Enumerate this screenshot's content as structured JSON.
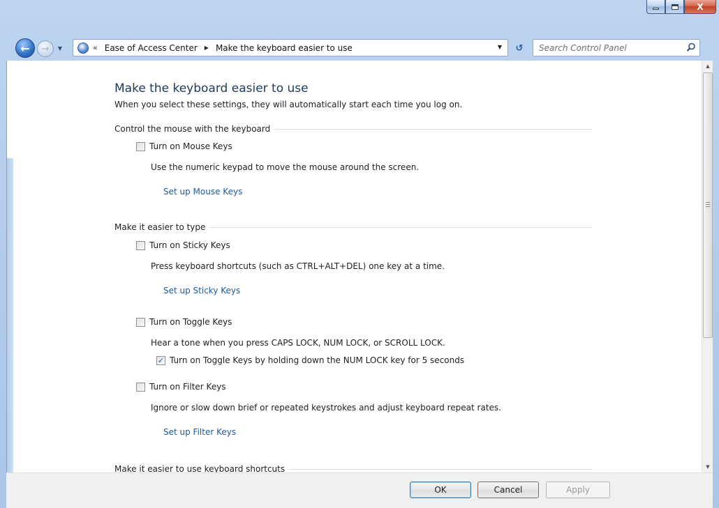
{
  "window": {
    "close_glyph": "X",
    "accent_color": "#1c5a9b",
    "frame_color": "#a9c6e8"
  },
  "navigation": {
    "breadcrumb_chevrons": "«",
    "breadcrumb": [
      "Ease of Access Center",
      "Make the keyboard easier to use"
    ],
    "search_placeholder": "Search Control Panel"
  },
  "page": {
    "title": "Make the keyboard easier to use",
    "description": "When you select these settings, they will automatically start each time you log on."
  },
  "sections": [
    {
      "label": "Control the mouse with the keyboard",
      "items": [
        {
          "checkbox_label": "Turn on Mouse Keys",
          "checked": false,
          "description": "Use the numeric keypad to move the mouse around the screen.",
          "link": "Set up Mouse Keys"
        }
      ]
    },
    {
      "label": "Make it easier to type",
      "items": [
        {
          "checkbox_label": "Turn on Sticky Keys",
          "checked": false,
          "description": "Press keyboard shortcuts (such as CTRL+ALT+DEL) one key at a time.",
          "link": "Set up Sticky Keys"
        },
        {
          "checkbox_label": "Turn on Toggle Keys",
          "checked": false,
          "description": "Hear a tone when you press CAPS LOCK, NUM LOCK, or SCROLL LOCK.",
          "sub_checkbox_label": "Turn on Toggle Keys by holding down the NUM LOCK key for 5 seconds",
          "sub_checked": true
        },
        {
          "checkbox_label": "Turn on Filter Keys",
          "checked": false,
          "description": "Ignore or slow down brief or repeated keystrokes and adjust keyboard repeat rates.",
          "link": "Set up Filter Keys"
        }
      ]
    },
    {
      "label": "Make it easier to use keyboard shortcuts"
    }
  ],
  "buttons": {
    "ok": "OK",
    "cancel": "Cancel",
    "apply": "Apply"
  },
  "check_mark": "✓"
}
